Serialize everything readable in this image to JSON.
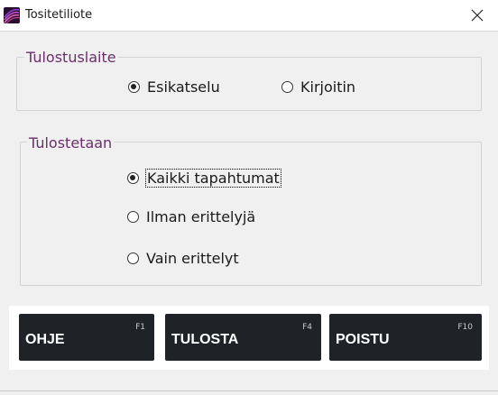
{
  "window": {
    "title": "Tositetiliote",
    "icon": "app-logo-icon",
    "close_icon": "close-icon"
  },
  "printer_group": {
    "legend": "Tulostuslaite",
    "options": [
      {
        "label": "Esikatselu",
        "checked": true
      },
      {
        "label": "Kirjoitin",
        "checked": false
      }
    ]
  },
  "print_group": {
    "legend": "Tulostetaan",
    "options": [
      {
        "label": "Kaikki tapahtumat",
        "checked": true
      },
      {
        "label": "Ilman erittelyjä",
        "checked": false
      },
      {
        "label": "Vain erittelyt",
        "checked": false
      }
    ]
  },
  "buttons": [
    {
      "label": "OHJE",
      "key": "F1"
    },
    {
      "label": "TULOSTA",
      "key": "F4"
    },
    {
      "label": "POISTU",
      "key": "F10"
    }
  ],
  "colors": {
    "legend": "#6b2f6b",
    "button_bg": "#1f2328"
  }
}
